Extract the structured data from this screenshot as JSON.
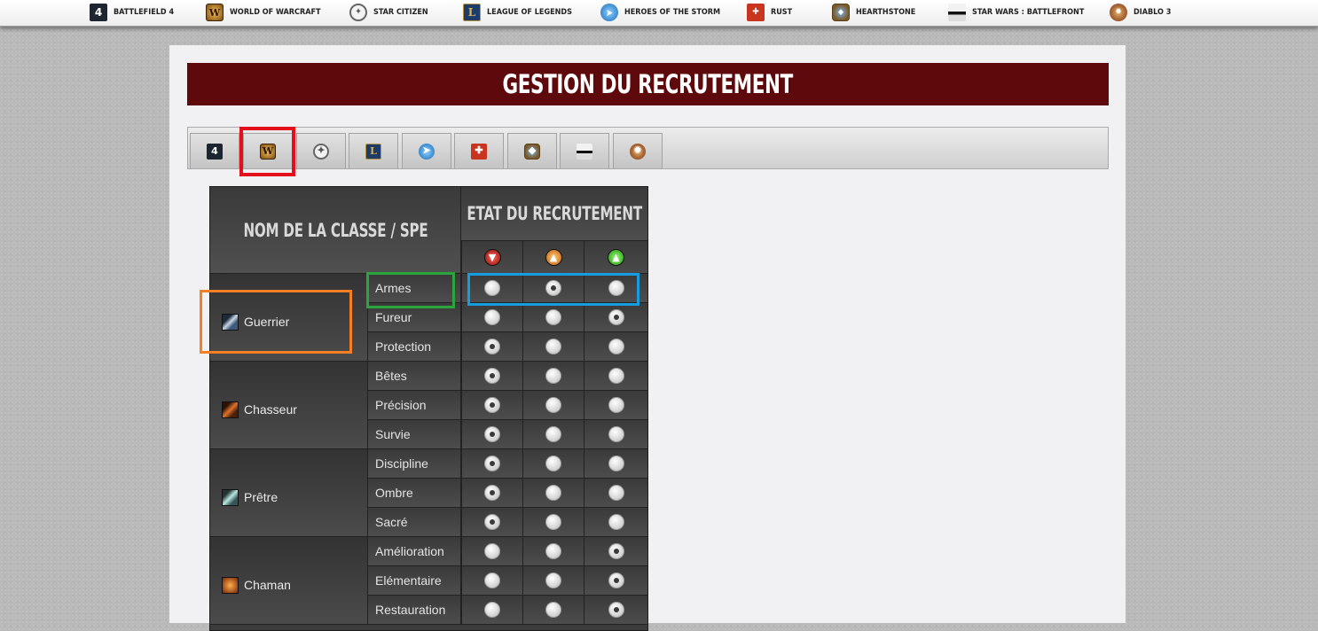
{
  "nav": {
    "items": [
      {
        "label": "BATTLEFIELD 4",
        "icon": "battlefield-4-icon",
        "glyph": "4"
      },
      {
        "label": "WORLD OF WARCRAFT",
        "icon": "world-of-warcraft-icon",
        "glyph": "W"
      },
      {
        "label": "STAR CITIZEN",
        "icon": "star-citizen-icon",
        "glyph": "✦"
      },
      {
        "label": "LEAGUE OF LEGENDS",
        "icon": "league-of-legends-icon",
        "glyph": "L"
      },
      {
        "label": "HEROES OF THE STORM",
        "icon": "heroes-of-the-storm-icon",
        "glyph": "➤"
      },
      {
        "label": "RUST",
        "icon": "rust-icon",
        "glyph": "✚"
      },
      {
        "label": "HEARTHSTONE",
        "icon": "hearthstone-icon",
        "glyph": "◆"
      },
      {
        "label": "STAR WARS : BATTLEFRONT",
        "icon": "star-wars-battlefront-icon",
        "glyph": ""
      },
      {
        "label": "DIABLO 3",
        "icon": "diablo-3-icon",
        "glyph": "✹"
      }
    ]
  },
  "page": {
    "title": "GESTION DU RECRUTEMENT"
  },
  "tabs": {
    "selected_index": 1
  },
  "table": {
    "header_class": "NOM DE LA CLASSE / SPE",
    "header_state": "ETAT DU RECRUTEMENT",
    "status_icons": [
      {
        "icon": "recruitment-closed-icon",
        "color": "#c1150c",
        "glyph": "▼"
      },
      {
        "icon": "recruitment-medium-icon",
        "color": "#e47a15",
        "glyph": "▲"
      },
      {
        "icon": "recruitment-open-icon",
        "color": "#2cae15",
        "glyph": "▲"
      }
    ],
    "classes": [
      {
        "name": "Guerrier",
        "icon": "guerrier-icon",
        "specs": [
          {
            "name": "Armes",
            "selected": 1
          },
          {
            "name": "Fureur",
            "selected": 2
          },
          {
            "name": "Protection",
            "selected": 0
          }
        ]
      },
      {
        "name": "Chasseur",
        "icon": "chasseur-icon",
        "specs": [
          {
            "name": "Bêtes",
            "selected": 0
          },
          {
            "name": "Précision",
            "selected": 0
          },
          {
            "name": "Survie",
            "selected": 0
          }
        ]
      },
      {
        "name": "Prêtre",
        "icon": "pretre-icon",
        "specs": [
          {
            "name": "Discipline",
            "selected": 0
          },
          {
            "name": "Ombre",
            "selected": 0
          },
          {
            "name": "Sacré",
            "selected": 0
          }
        ]
      },
      {
        "name": "Chaman",
        "icon": "chaman-icon",
        "specs": [
          {
            "name": "Amélioration",
            "selected": 2
          },
          {
            "name": "Elémentaire",
            "selected": 2
          },
          {
            "name": "Restauration",
            "selected": 2
          }
        ]
      }
    ]
  },
  "colors": {
    "title_bar": "#5e0a0d",
    "highlight_red": "#e3101b",
    "highlight_orange": "#f47f25",
    "highlight_green": "#2aa63d",
    "highlight_blue": "#169de0"
  }
}
